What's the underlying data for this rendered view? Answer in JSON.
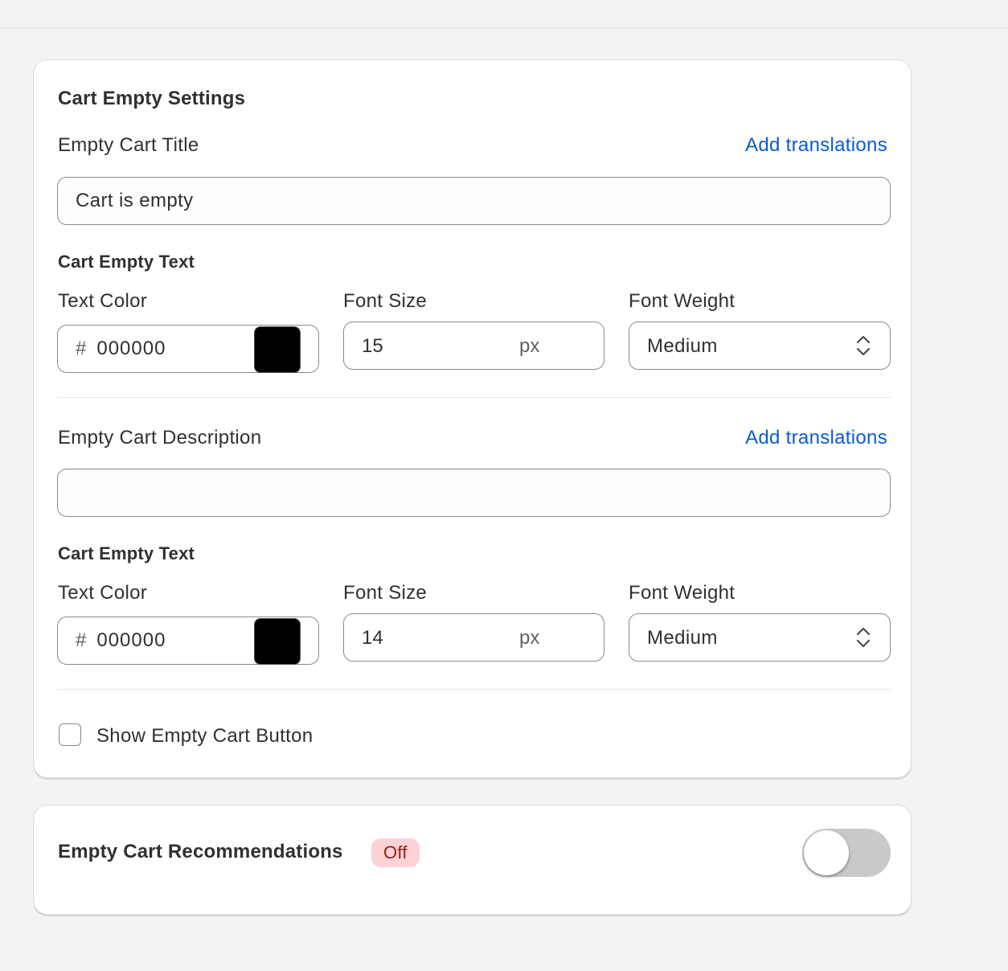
{
  "settings_card": {
    "title": "Cart Empty Settings",
    "title_field": {
      "label": "Empty Cart Title",
      "translations_link": "Add translations",
      "value": "Cart is empty"
    },
    "title_style": {
      "heading": "Cart Empty Text",
      "text_color_label": "Text Color",
      "text_color_hash": "#",
      "text_color_value": "000000",
      "swatch_color": "#000000",
      "font_size_label": "Font Size",
      "font_size_value": "15",
      "font_size_unit": "px",
      "font_weight_label": "Font Weight",
      "font_weight_value": "Medium"
    },
    "description_field": {
      "label": "Empty Cart Description",
      "translations_link": "Add translations",
      "value": ""
    },
    "description_style": {
      "heading": "Cart Empty Text",
      "text_color_label": "Text Color",
      "text_color_hash": "#",
      "text_color_value": "000000",
      "swatch_color": "#000000",
      "font_size_label": "Font Size",
      "font_size_value": "14",
      "font_size_unit": "px",
      "font_weight_label": "Font Weight",
      "font_weight_value": "Medium"
    },
    "show_button": {
      "label": "Show Empty Cart Button",
      "checked": false
    }
  },
  "recommendations_card": {
    "title": "Empty Cart Recommendations",
    "status_badge": "Off",
    "enabled": false
  },
  "colors": {
    "link": "#0a5bd1",
    "badge_bg": "#fed1d7",
    "toggle_off": "#c9c9c9"
  }
}
